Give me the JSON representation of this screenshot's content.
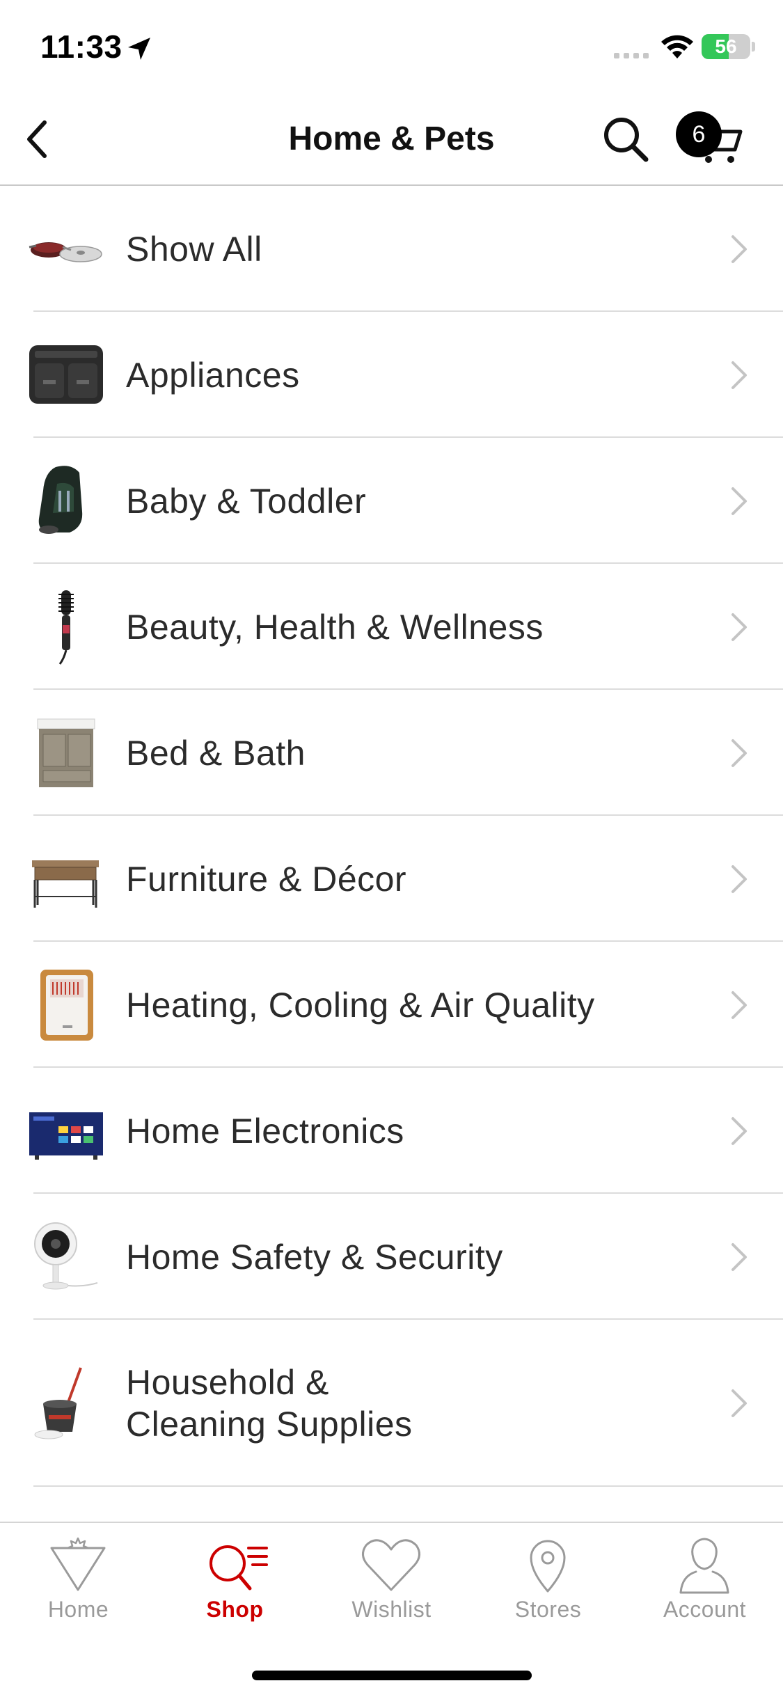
{
  "status_bar": {
    "time": "11:33",
    "battery": "56",
    "battery_level": 0.56,
    "icons": [
      "location-arrow-icon",
      "cellular-signal-icon",
      "wifi-icon",
      "battery-charging-icon"
    ]
  },
  "nav": {
    "title": "Home & Pets",
    "cart_count": "6",
    "icons": [
      "back-chevron-icon",
      "search-icon",
      "cart-icon"
    ]
  },
  "categories": [
    {
      "label": "Show All",
      "image": "cookware-pans"
    },
    {
      "label": "Appliances",
      "image": "air-fryer"
    },
    {
      "label": "Baby & Toddler",
      "image": "car-seat"
    },
    {
      "label": "Beauty, Health & Wellness",
      "image": "hair-dryer-brush"
    },
    {
      "label": "Bed & Bath",
      "image": "bathroom-vanity"
    },
    {
      "label": "Furniture & Décor",
      "image": "console-table"
    },
    {
      "label": "Heating, Cooling & Air Quality",
      "image": "space-heater"
    },
    {
      "label": "Home Electronics",
      "image": "smart-tv"
    },
    {
      "label": "Home Safety & Security",
      "image": "security-camera"
    },
    {
      "label": "Household &\nCleaning Supplies",
      "image": "spin-mop-bucket"
    }
  ],
  "tabs": [
    {
      "label": "Home",
      "icon": "home-triangle-icon",
      "active": false
    },
    {
      "label": "Shop",
      "icon": "shop-search-icon",
      "active": true
    },
    {
      "label": "Wishlist",
      "icon": "heart-icon",
      "active": false
    },
    {
      "label": "Stores",
      "icon": "map-pin-icon",
      "active": false
    },
    {
      "label": "Account",
      "icon": "person-icon",
      "active": false
    }
  ],
  "colors": {
    "accent": "#cc0000",
    "inactive_tab": "#9a9a9a",
    "battery": "#34c759",
    "text": "#2b2b2b"
  }
}
